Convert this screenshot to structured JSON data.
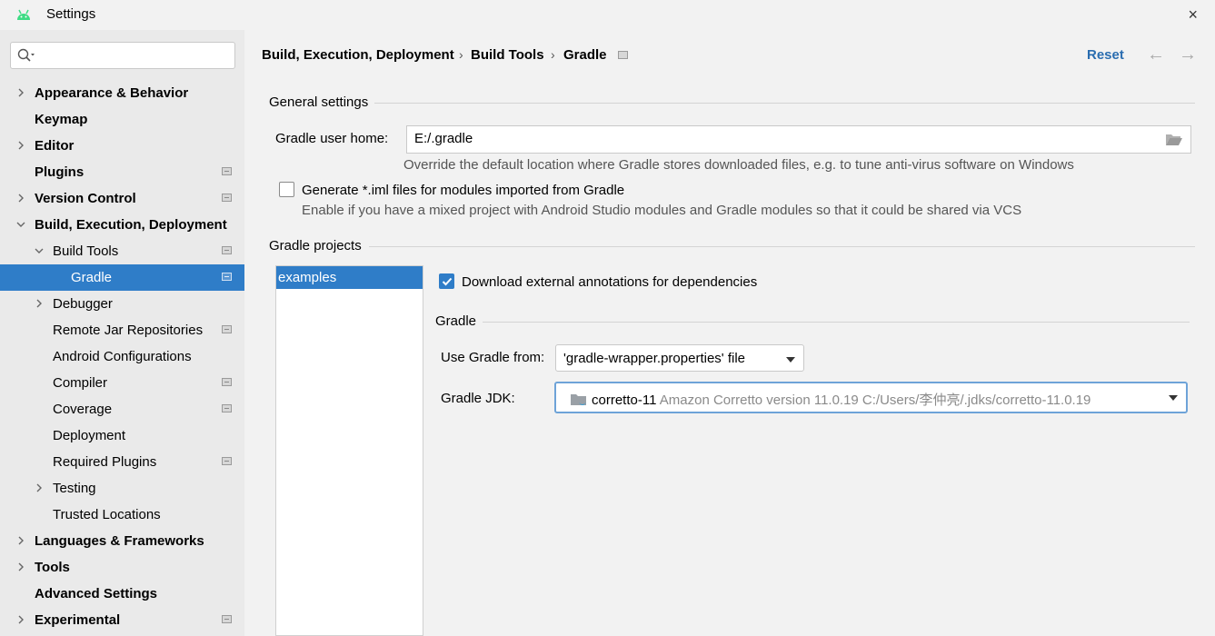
{
  "window": {
    "title": "Settings",
    "close_icon": "×"
  },
  "search": {
    "placeholder": ""
  },
  "sidebar": {
    "items": [
      {
        "label": "Appearance & Behavior",
        "bold": true,
        "chevron": "right",
        "project": false
      },
      {
        "label": "Keymap",
        "bold": true,
        "chevron": "",
        "project": false
      },
      {
        "label": "Editor",
        "bold": true,
        "chevron": "right",
        "project": false
      },
      {
        "label": "Plugins",
        "bold": true,
        "chevron": "",
        "project": true
      },
      {
        "label": "Version Control",
        "bold": true,
        "chevron": "right",
        "project": true
      },
      {
        "label": "Build, Execution, Deployment",
        "bold": true,
        "chevron": "down",
        "project": false
      },
      {
        "label": "Build Tools",
        "bold": false,
        "chevron": "down",
        "project": true
      },
      {
        "label": "Gradle",
        "bold": false,
        "chevron": "",
        "project": true,
        "selected": true
      },
      {
        "label": "Debugger",
        "bold": false,
        "chevron": "right",
        "project": false
      },
      {
        "label": "Remote Jar Repositories",
        "bold": false,
        "chevron": "",
        "project": true
      },
      {
        "label": "Android Configurations",
        "bold": false,
        "chevron": "",
        "project": false
      },
      {
        "label": "Compiler",
        "bold": false,
        "chevron": "",
        "project": true
      },
      {
        "label": "Coverage",
        "bold": false,
        "chevron": "",
        "project": true
      },
      {
        "label": "Deployment",
        "bold": false,
        "chevron": "",
        "project": false
      },
      {
        "label": "Required Plugins",
        "bold": false,
        "chevron": "",
        "project": true
      },
      {
        "label": "Testing",
        "bold": false,
        "chevron": "right",
        "project": false
      },
      {
        "label": "Trusted Locations",
        "bold": false,
        "chevron": "",
        "project": false
      },
      {
        "label": "Languages & Frameworks",
        "bold": true,
        "chevron": "right",
        "project": false
      },
      {
        "label": "Tools",
        "bold": true,
        "chevron": "right",
        "project": false
      },
      {
        "label": "Advanced Settings",
        "bold": true,
        "chevron": "",
        "project": false
      },
      {
        "label": "Experimental",
        "bold": true,
        "chevron": "right",
        "project": true
      }
    ]
  },
  "breadcrumb": {
    "part1": "Build, Execution, Deployment",
    "part2": "Build Tools",
    "part3": "Gradle",
    "sep": "›"
  },
  "header": {
    "reset": "Reset",
    "back": "←",
    "forward": "→"
  },
  "general": {
    "title": "General settings",
    "user_home_label": "Gradle user home:",
    "user_home_value": "E:/.gradle",
    "user_home_hint": "Override the default location where Gradle stores downloaded files, e.g. to tune anti-virus software on Windows",
    "iml_label": "Generate *.iml files for modules imported from Gradle",
    "iml_hint": "Enable if you have a mixed project with Android Studio modules and Gradle modules so that it could be shared via VCS",
    "iml_checked": false
  },
  "projects": {
    "title": "Gradle projects",
    "list": [
      "examples"
    ],
    "download_annotations_label": "Download external annotations for dependencies",
    "download_annotations_checked": true,
    "gradle_title": "Gradle",
    "use_from_label": "Use Gradle from:",
    "use_from_value": "'gradle-wrapper.properties' file",
    "jdk_label": "Gradle JDK:",
    "jdk_name": "corretto-11",
    "jdk_detail": "Amazon Corretto version 11.0.19 C:/Users/李仲亮/.jdks/corretto-11.0.19"
  },
  "colors": {
    "accent": "#2f7dc8",
    "link": "#2a6db0",
    "sidebar_bg": "#eaeaea",
    "content_bg": "#f2f2f2"
  }
}
